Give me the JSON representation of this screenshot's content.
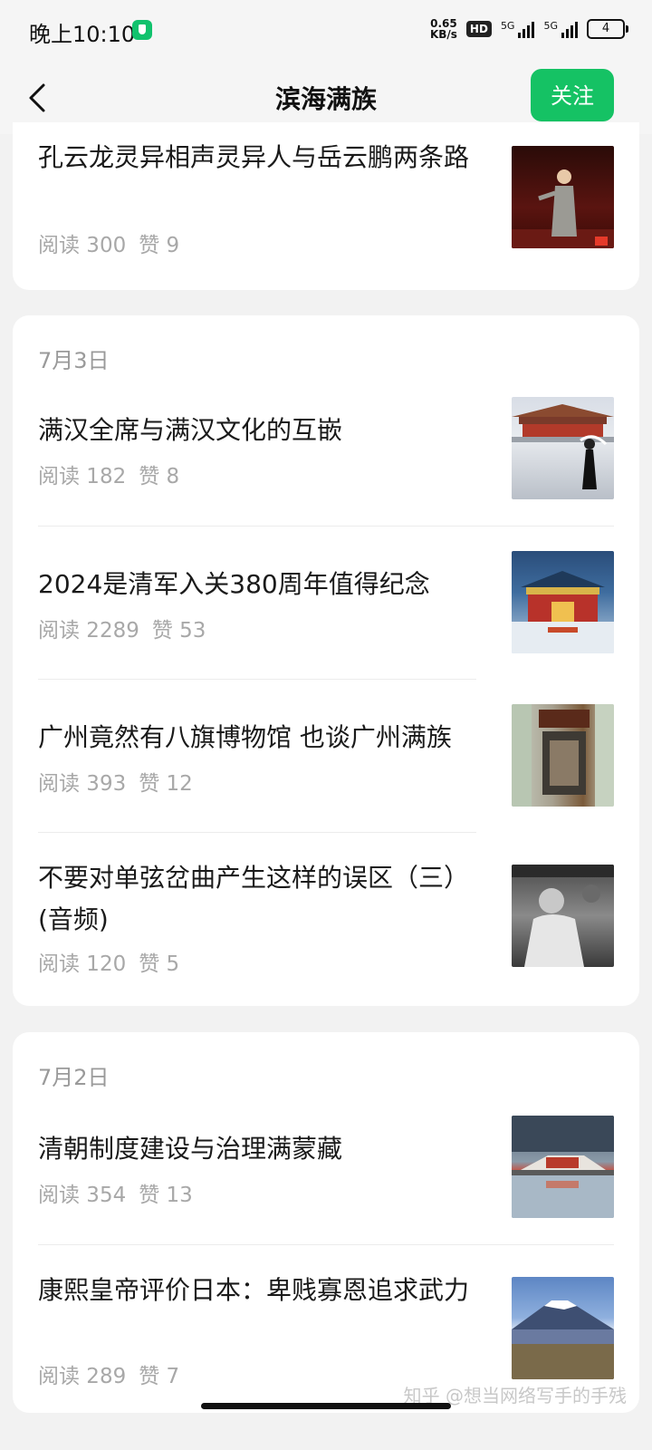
{
  "status_bar": {
    "time": "晚上10:10",
    "speed_top": "0.65",
    "speed_bottom": "KB/s",
    "hd": "HD",
    "net1": "5G",
    "net2": "5G",
    "battery": "4"
  },
  "header": {
    "title": "滨海满族",
    "follow_label": "关注"
  },
  "groups": [
    {
      "date": "",
      "items": [
        {
          "title": "孔云龙灵异相声灵异人与岳云鹏两条路",
          "reads": "阅读 300",
          "likes": "赞 9",
          "thumb": "performer-on-stage"
        }
      ]
    },
    {
      "date": "7月3日",
      "items": [
        {
          "title": "满汉全席与满汉文化的互嵌",
          "reads": "阅读 182",
          "likes": "赞 8",
          "thumb": "palace-courtyard"
        },
        {
          "title": "2024是清军入关380周年值得纪念",
          "reads": "阅读 2289",
          "likes": "赞 53",
          "thumb": "palace-snow"
        },
        {
          "title": "广州竟然有八旗博物馆 也谈广州满族",
          "reads": "阅读 393",
          "likes": "赞 12",
          "thumb": "museum-entrance"
        },
        {
          "title": "不要对单弦岔曲产生这样的误区（三）(音频)",
          "reads": "阅读 120",
          "likes": "赞 5",
          "thumb": "old-photo"
        }
      ]
    },
    {
      "date": "7月2日",
      "items": [
        {
          "title": "清朝制度建设与治理满蒙藏",
          "reads": "阅读 354",
          "likes": "赞 13",
          "thumb": "potala-reflection"
        },
        {
          "title": "康熙皇帝评价日本：卑贱寡恩追求武力",
          "reads": "阅读 289",
          "likes": "赞 7",
          "thumb": "mount-fuji"
        }
      ]
    }
  ],
  "watermark": "知乎 @想当网络写手的手残"
}
